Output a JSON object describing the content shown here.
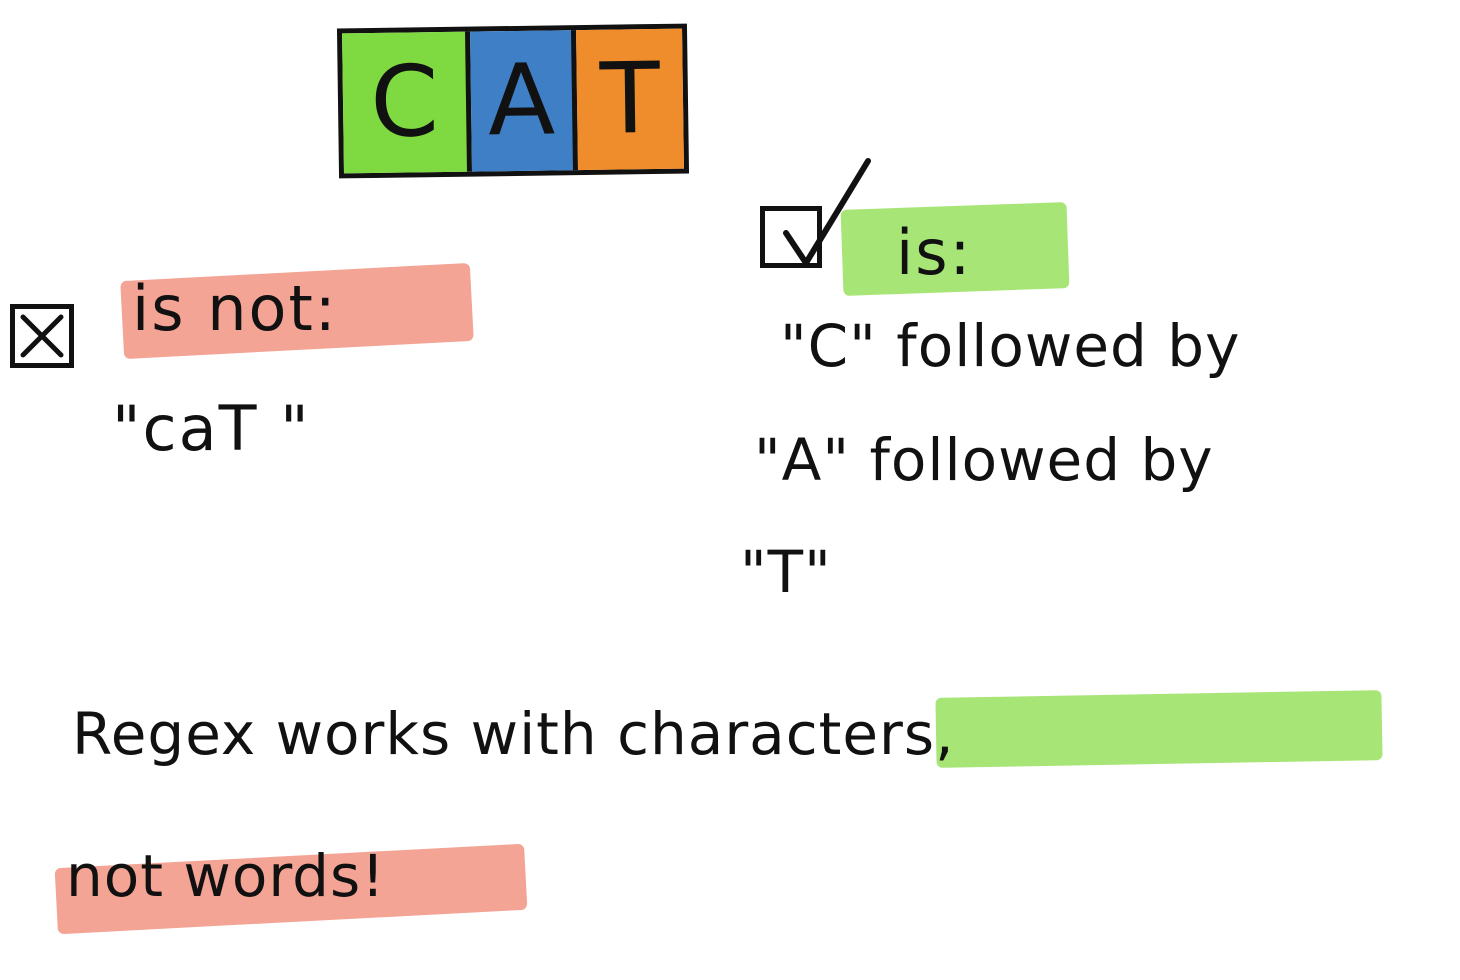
{
  "title": {
    "letters": [
      "C",
      "A",
      "T"
    ]
  },
  "left": {
    "label": "is not:",
    "example": "\"caT \""
  },
  "right": {
    "label": "is:",
    "lines": [
      "\"C\" followed by",
      "\"A\" followed by",
      "\"T\""
    ]
  },
  "footer": {
    "line1_prefix": "Regex works with ",
    "line1_highlight": "characters",
    "line1_suffix": ",",
    "line2_highlight": "not words",
    "line2_suffix": "!"
  },
  "colors": {
    "tile_c": "#7fd940",
    "tile_a": "#3f7fc6",
    "tile_t": "#ef8c2b",
    "highlight_red": "#f29a8a",
    "highlight_green": "#9fe268"
  }
}
